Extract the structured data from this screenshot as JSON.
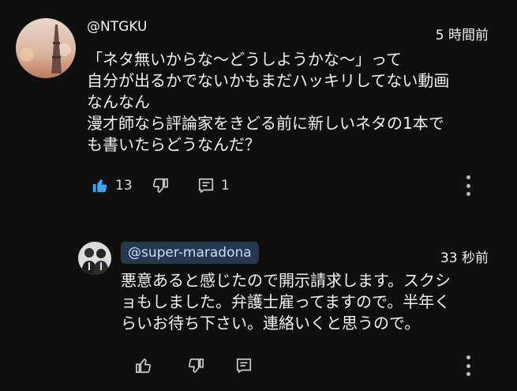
{
  "comments": [
    {
      "author": "@NTGKU",
      "time": "5 時間前",
      "lines": [
        "「ネタ無いからな～どうしようかな～」って",
        "自分が出るかでないかもまだハッキリしてない動画",
        "なんなん",
        "漫才師なら評論家をきどる前に新しいネタの1本で",
        "も書いたらどうなんだ？"
      ],
      "likes": "13",
      "replies": "1"
    },
    {
      "author": "@super-maradona",
      "time": "33 秒前",
      "lines": [
        "悪意あると感じたので開示請求します。スクシ",
        "ョもしました。弁護士雇ってますので。半年く",
        "らいお待ち下さい。連絡いくと思うので。"
      ]
    }
  ],
  "icons": {
    "like": "thumbs-up-icon",
    "dislike": "thumbs-down-icon",
    "reply": "reply-comment-icon",
    "more": "more-vert-icon"
  },
  "colors": {
    "background": "#0f0f0f",
    "like_active": "#3ea6ff",
    "mention_bg": "#263850"
  }
}
